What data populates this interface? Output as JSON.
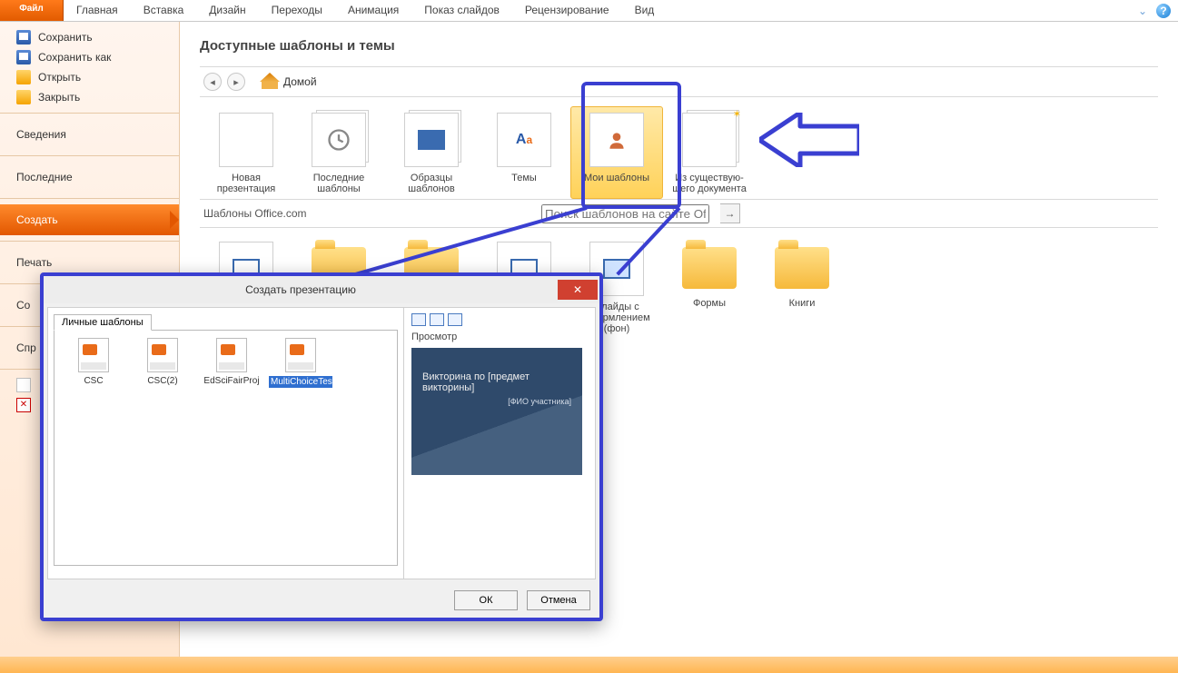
{
  "ribbon": {
    "file": "Файл",
    "tabs": [
      "Главная",
      "Вставка",
      "Дизайн",
      "Переходы",
      "Анимация",
      "Показ слайдов",
      "Рецензирование",
      "Вид"
    ]
  },
  "sidebar": {
    "save": "Сохранить",
    "save_as": "Сохранить как",
    "open": "Открыть",
    "close": "Закрыть",
    "info": "Сведения",
    "recent": "Последние",
    "new": "Создать",
    "print": "Печать",
    "share_cut": "Со",
    "help_cut": "Спр"
  },
  "content": {
    "heading": "Доступные шаблоны и темы",
    "home": "Домой",
    "office_label": "Шаблоны Office.com",
    "search_placeholder": "Поиск шаблонов на сайте Office.com",
    "templates": [
      {
        "label": "Новая презентация",
        "name": "tpl-new-presentation"
      },
      {
        "label": "Последние шаблоны",
        "name": "tpl-recent-templates"
      },
      {
        "label": "Образцы шаблонов",
        "name": "tpl-sample-templates"
      },
      {
        "label": "Темы",
        "name": "tpl-themes"
      },
      {
        "label": "Мои шаблоны",
        "name": "tpl-my-templates"
      },
      {
        "label": "Из существую-щего документа",
        "name": "tpl-from-existing"
      }
    ],
    "row2": [
      {
        "label": "",
        "name": "tpl-office-blank1",
        "kind": "doc"
      },
      {
        "label": "",
        "name": "tpl-office-blank2",
        "kind": "doc"
      },
      {
        "label": "",
        "name": "tpl-office-blank3",
        "kind": "doc"
      },
      {
        "label": "",
        "name": "tpl-office-blank4",
        "kind": "doc"
      },
      {
        "label": "Слайды с оформлением (фон)",
        "name": "cat-slide-designs",
        "kind": "doc"
      },
      {
        "label": "Формы",
        "name": "cat-forms",
        "kind": "folder"
      },
      {
        "label": "Книги",
        "name": "cat-books",
        "kind": "folder"
      }
    ]
  },
  "dialog": {
    "title": "Создать презентацию",
    "tab": "Личные шаблоны",
    "files": [
      "CSC",
      "CSC(2)",
      "EdSciFairProj",
      "MultiChoiceTest"
    ],
    "preview_label": "Просмотр",
    "preview_title": "Викторина по [предмет викторины]",
    "preview_sub": "[ФИО участника]",
    "ok": "ОК",
    "cancel": "Отмена"
  }
}
